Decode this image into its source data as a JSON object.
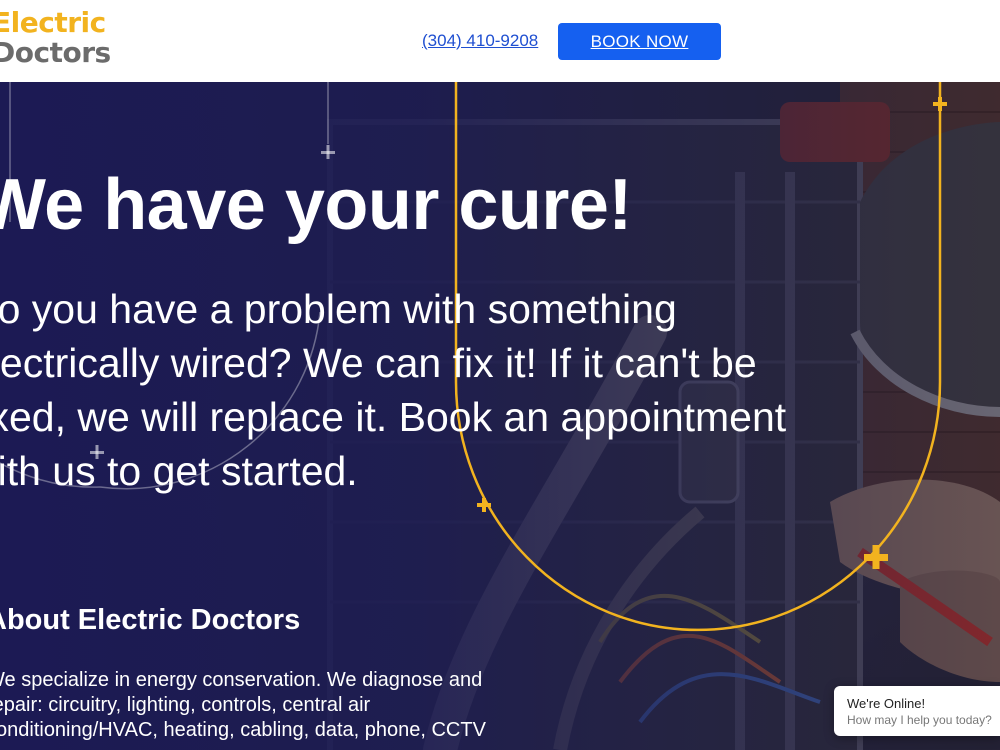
{
  "header": {
    "logo_line1": "Electric",
    "logo_line2": "Doctors",
    "phone": "(304) 410-9208",
    "book_button": "BOOK NOW"
  },
  "hero": {
    "title": "We have your cure!",
    "body_lines": [
      "Do you have a problem with something",
      "electrically wired? We can fix it! If it can't be",
      "fixed, we will replace it. Book an appointment",
      "with us to get started."
    ]
  },
  "about": {
    "title": "About Electric Doctors",
    "body_lines": [
      "We specialize in energy conservation. We diagnose and",
      "repair: circuitry, lighting, controls, central air",
      "conditioning/HVAC, heating, cabling, data, phone, CCTV"
    ]
  },
  "chat": {
    "status": "We're Online!",
    "prompt": "How may I help you today?"
  },
  "colors": {
    "brand_yellow": "#f2b31f",
    "brand_gray": "#6b6b6b",
    "button_blue": "#1560f0",
    "link_blue": "#1f4fd1",
    "hero_overlay": "#1b1b4a"
  }
}
